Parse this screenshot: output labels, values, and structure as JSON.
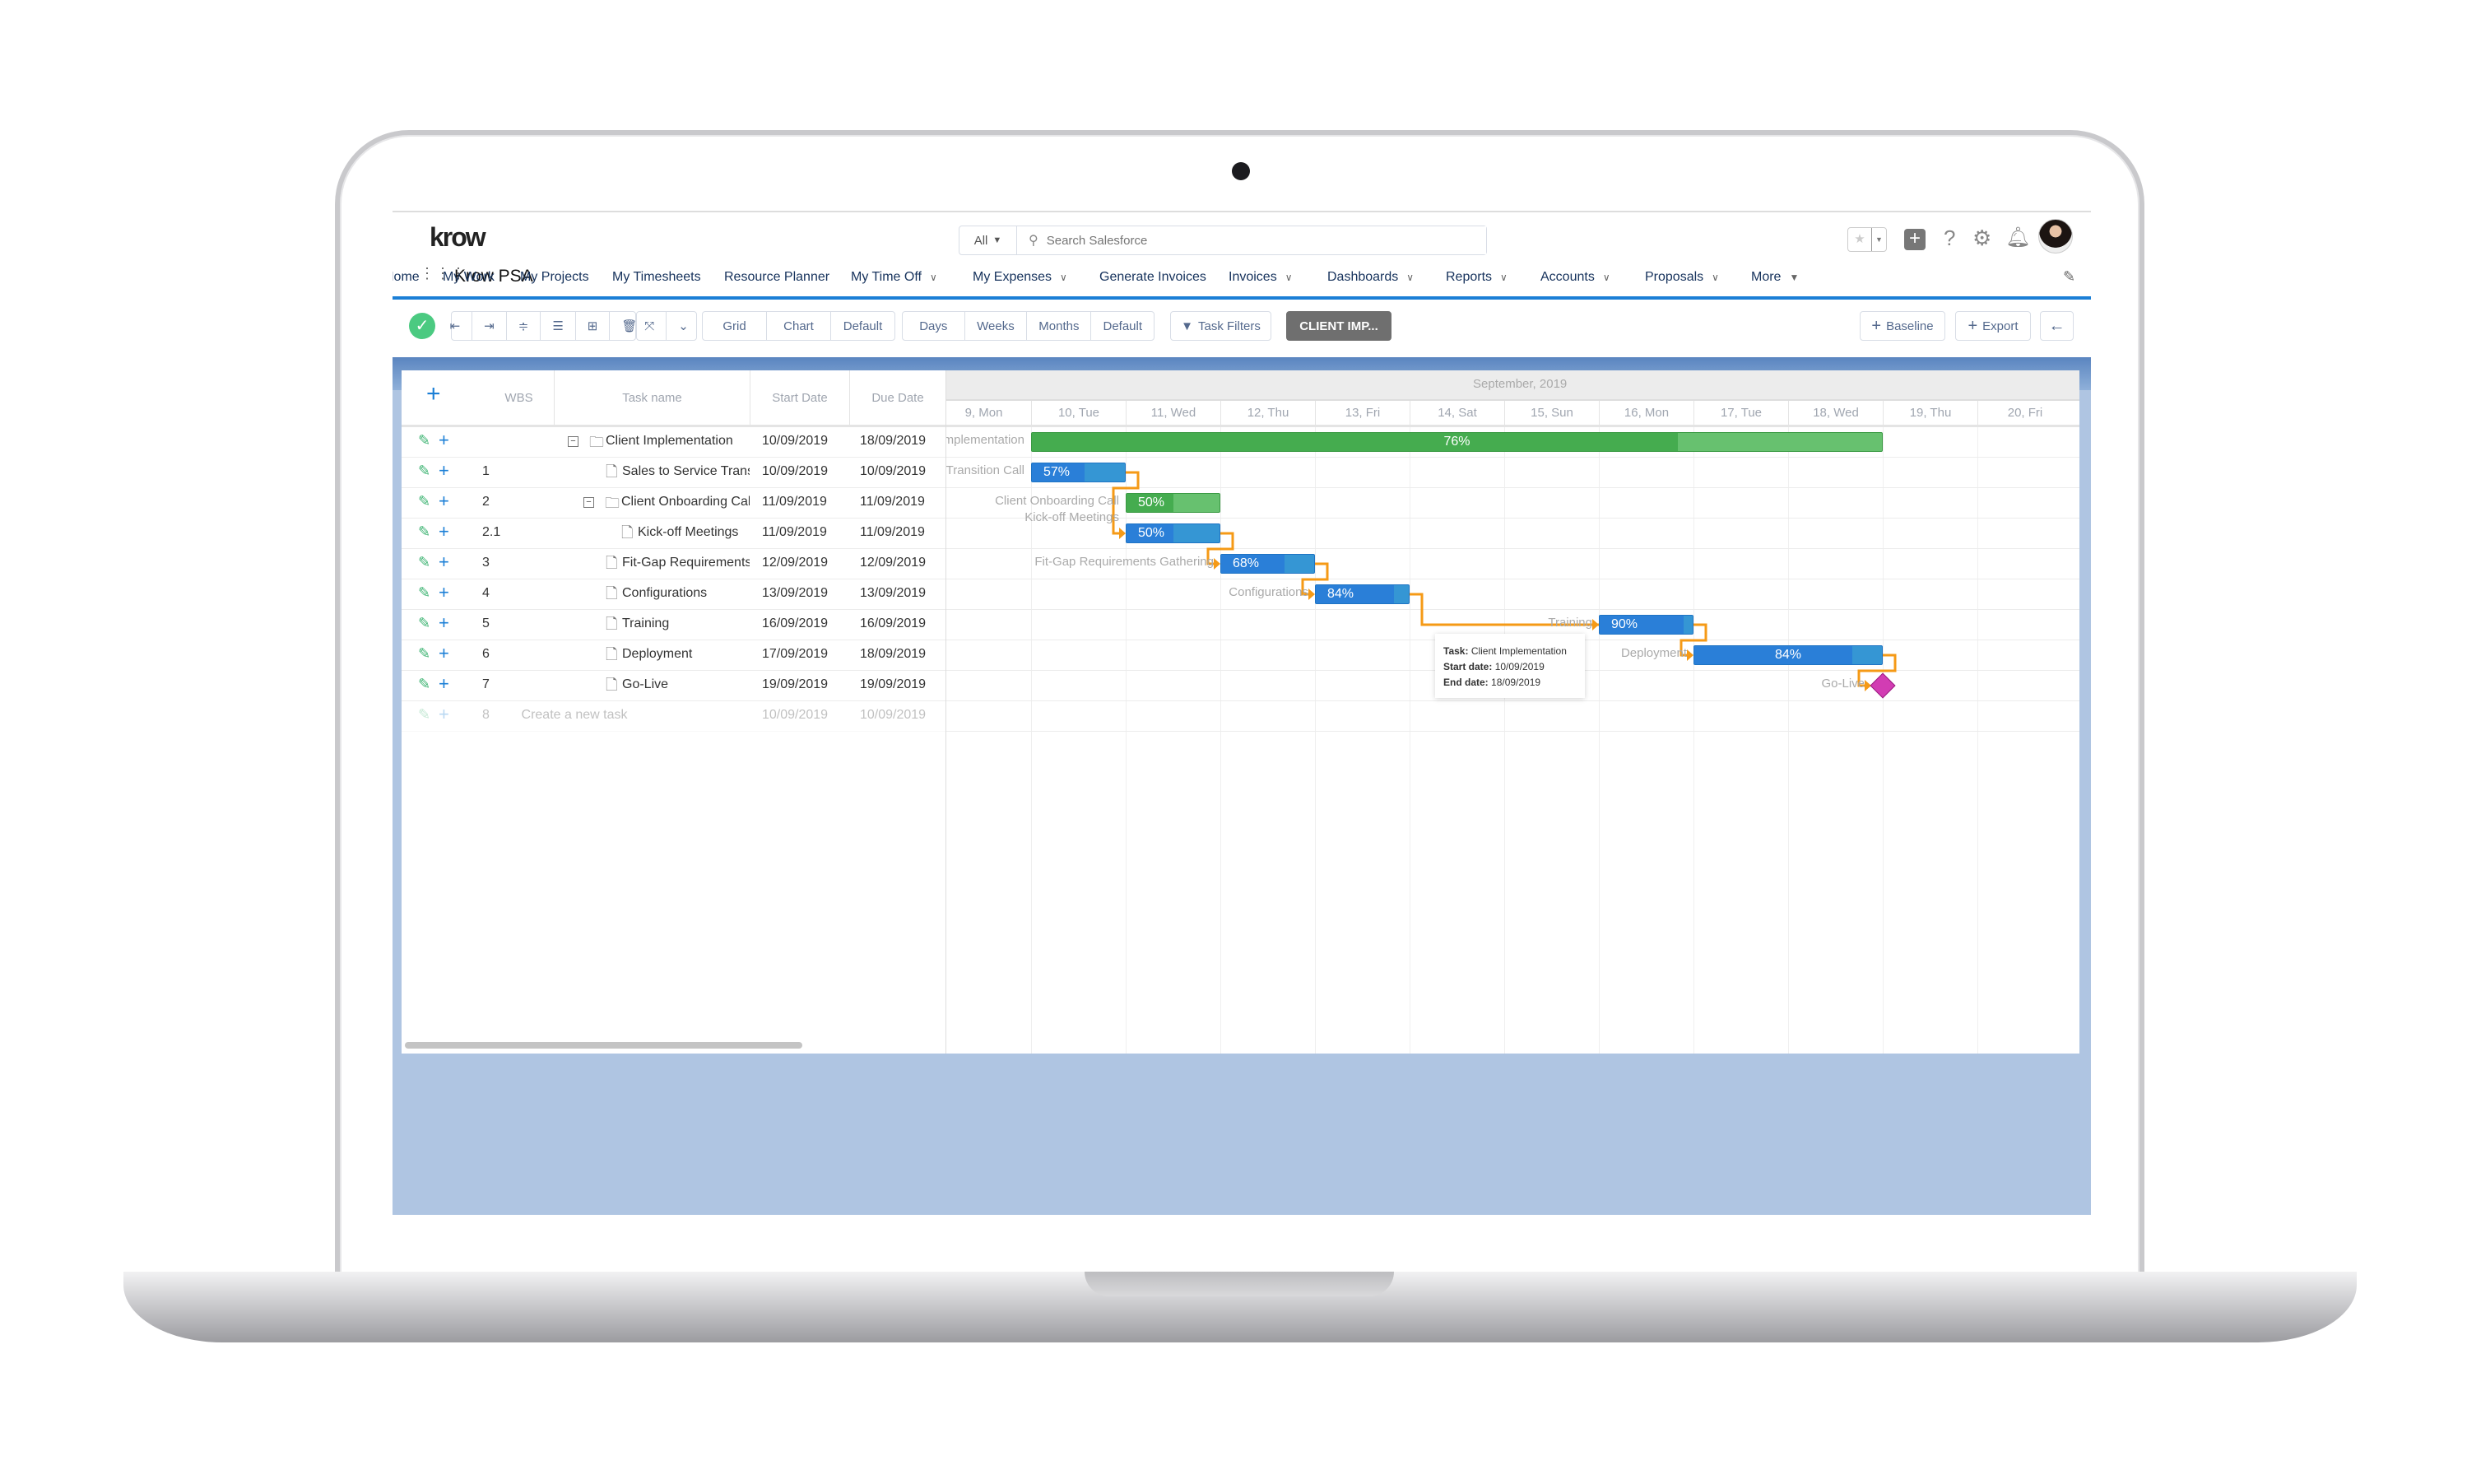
{
  "header": {
    "logo": "krow",
    "search_scope": "All",
    "search_placeholder": "Search Salesforce",
    "app_name": "Krow PSA"
  },
  "nav": [
    {
      "label": "Home",
      "dropdown": false
    },
    {
      "label": "My Work",
      "dropdown": false
    },
    {
      "label": "My Projects",
      "dropdown": false
    },
    {
      "label": "My Timesheets",
      "dropdown": false
    },
    {
      "label": "Resource Planner",
      "dropdown": false
    },
    {
      "label": "My Time Off",
      "dropdown": true
    },
    {
      "label": "My Expenses",
      "dropdown": true
    },
    {
      "label": "Generate Invoices",
      "dropdown": false
    },
    {
      "label": "Invoices",
      "dropdown": true
    },
    {
      "label": "Dashboards",
      "dropdown": true
    },
    {
      "label": "Reports",
      "dropdown": true
    },
    {
      "label": "Accounts",
      "dropdown": true
    },
    {
      "label": "Proposals",
      "dropdown": true
    },
    {
      "label": "More",
      "dropdown": true
    }
  ],
  "toolbar": {
    "view_group": [
      "Grid",
      "Chart",
      "Default"
    ],
    "scale_group": [
      "Days",
      "Weeks",
      "Months",
      "Default"
    ],
    "task_filters": "Task Filters",
    "project_button": "CLIENT IMP...",
    "baseline": "Baseline",
    "export": "Export"
  },
  "grid": {
    "columns": {
      "wbs": "WBS",
      "task": "Task name",
      "start": "Start Date",
      "due": "Due Date"
    },
    "rows": [
      {
        "wbs": "",
        "name": "Client Implementation",
        "start": "10/09/2019",
        "due": "18/09/2019",
        "level": 0,
        "type": "folder"
      },
      {
        "wbs": "1",
        "name": "Sales to Service Transition Call",
        "start": "10/09/2019",
        "due": "10/09/2019",
        "level": 1,
        "type": "file"
      },
      {
        "wbs": "2",
        "name": "Client Onboarding Call",
        "start": "11/09/2019",
        "due": "11/09/2019",
        "level": 1,
        "type": "folder"
      },
      {
        "wbs": "2.1",
        "name": "Kick-off Meetings",
        "start": "11/09/2019",
        "due": "11/09/2019",
        "level": 2,
        "type": "file"
      },
      {
        "wbs": "3",
        "name": "Fit-Gap Requirements",
        "start": "12/09/2019",
        "due": "12/09/2019",
        "level": 1,
        "type": "file"
      },
      {
        "wbs": "4",
        "name": "Configurations",
        "start": "13/09/2019",
        "due": "13/09/2019",
        "level": 1,
        "type": "file"
      },
      {
        "wbs": "5",
        "name": "Training",
        "start": "16/09/2019",
        "due": "16/09/2019",
        "level": 1,
        "type": "file"
      },
      {
        "wbs": "6",
        "name": "Deployment",
        "start": "17/09/2019",
        "due": "18/09/2019",
        "level": 1,
        "type": "file"
      },
      {
        "wbs": "7",
        "name": "Go-Live",
        "start": "19/09/2019",
        "due": "19/09/2019",
        "level": 1,
        "type": "file"
      }
    ],
    "new_row": {
      "wbs": "8",
      "name": "Create a new task",
      "start": "10/09/2019",
      "due": "10/09/2019"
    }
  },
  "gantt": {
    "month": "September, 2019",
    "days": [
      "9, Mon",
      "10, Tue",
      "11, Wed",
      "12, Thu",
      "13, Fri",
      "14, Sat",
      "15, Sun",
      "16, Mon",
      "17, Tue",
      "18, Wed",
      "19, Thu",
      "20, Fri"
    ],
    "first_day": 9,
    "tasks": [
      {
        "label": "Client Implementation",
        "start": 10,
        "days": 9,
        "progress": 76,
        "kind": "summary"
      },
      {
        "label": "Sales to Service Transition Call",
        "start": 10,
        "days": 1,
        "progress": 57,
        "kind": "task"
      },
      {
        "label": "Client Onboarding Call",
        "start": 11,
        "days": 1,
        "progress": 50,
        "kind": "summary"
      },
      {
        "label": "Kick-off Meetings",
        "start": 11,
        "days": 1,
        "progress": 50,
        "kind": "task"
      },
      {
        "label": "Fit-Gap Requirements Gathering",
        "start": 12,
        "days": 1,
        "progress": 68,
        "kind": "task"
      },
      {
        "label": "Configurations",
        "start": 13,
        "days": 1,
        "progress": 84,
        "kind": "task"
      },
      {
        "label": "Training",
        "start": 16,
        "days": 1,
        "progress": 90,
        "kind": "task"
      },
      {
        "label": "Deployment",
        "start": 17,
        "days": 2,
        "progress": 84,
        "kind": "task"
      },
      {
        "label": "Go-Live",
        "start": 19,
        "days": 0,
        "progress": 0,
        "kind": "milestone"
      }
    ],
    "links": [
      [
        1,
        3
      ],
      [
        3,
        4
      ],
      [
        4,
        5
      ],
      [
        5,
        6
      ],
      [
        6,
        7
      ],
      [
        7,
        8
      ]
    ],
    "tooltip": {
      "task_label": "Task:",
      "task": "Client Implementation",
      "start_label": "Start date:",
      "start": "10/09/2019",
      "end_label": "End date:",
      "end": "18/09/2019"
    }
  },
  "colors": {
    "task": "#2a7fd8",
    "task_rest": "#3596d4",
    "summary": "#45ac4f",
    "summary_rest": "#67c16f",
    "link": "#f59a16",
    "milestone": "#d23cb3",
    "accent": "#1b7fd6"
  }
}
